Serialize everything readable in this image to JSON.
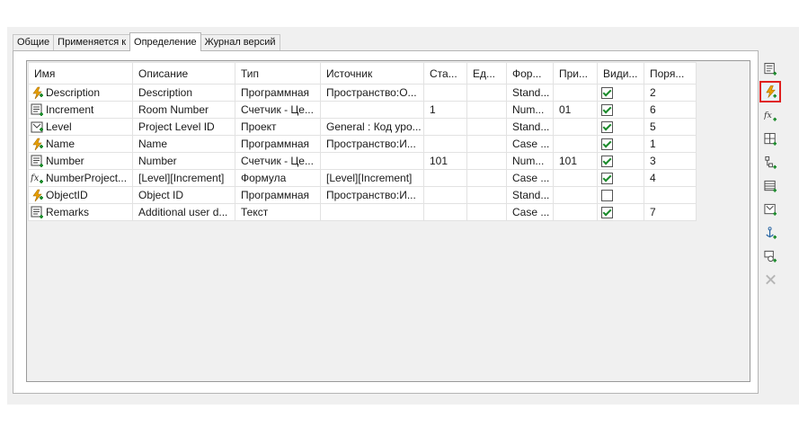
{
  "tabs": [
    "Общие",
    "Применяется к",
    "Определение",
    "Журнал версий"
  ],
  "active_tab": "Определение",
  "table": {
    "headers": [
      "Имя",
      "Описание",
      "Тип",
      "Источник",
      "Ста...",
      "Ед...",
      "Фор...",
      "При...",
      "Види...",
      "Поря..."
    ],
    "rows": [
      {
        "icon": "lightning-icon",
        "name": "Description",
        "desc": "Description",
        "type": "Программная",
        "source": "Пространство:О...",
        "start": "",
        "unit": "",
        "format": "Stand...",
        "prefix": "",
        "visible": true,
        "order": "2"
      },
      {
        "icon": "counter-icon",
        "name": "Increment",
        "desc": "Room Number",
        "type": "Счетчик - Це...",
        "source": "",
        "start": "1",
        "unit": "",
        "format": "Num...",
        "prefix": "01",
        "visible": true,
        "order": "6"
      },
      {
        "icon": "project-icon",
        "name": "Level",
        "desc": "Project Level ID",
        "type": "Проект",
        "source": "General : Код уро...",
        "start": "",
        "unit": "",
        "format": "Stand...",
        "prefix": "",
        "visible": true,
        "order": "5"
      },
      {
        "icon": "lightning-icon",
        "name": "Name",
        "desc": "Name",
        "type": "Программная",
        "source": "Пространство:И...",
        "start": "",
        "unit": "",
        "format": "Case ...",
        "prefix": "",
        "visible": true,
        "order": "1"
      },
      {
        "icon": "counter-icon",
        "name": "Number",
        "desc": "Number",
        "type": "Счетчик - Це...",
        "source": "",
        "start": "101",
        "unit": "",
        "format": "Num...",
        "prefix": "101",
        "visible": true,
        "order": "3"
      },
      {
        "icon": "formula-icon",
        "name": "NumberProject...",
        "desc": "[Level][Increment]",
        "type": "Формула",
        "source": "[Level][Increment]",
        "start": "",
        "unit": "",
        "format": "Case ...",
        "prefix": "",
        "visible": true,
        "order": "4"
      },
      {
        "icon": "lightning-icon",
        "name": "ObjectID",
        "desc": "Object ID",
        "type": "Программная",
        "source": "Пространство:И...",
        "start": "",
        "unit": "",
        "format": "Stand...",
        "prefix": "",
        "visible": false,
        "order": ""
      },
      {
        "icon": "counter-icon",
        "name": "Remarks",
        "desc": "Additional user d...",
        "type": "Текст",
        "source": "",
        "start": "",
        "unit": "",
        "format": "Case ...",
        "prefix": "",
        "visible": true,
        "order": "7"
      }
    ]
  },
  "toolbar": [
    {
      "icon": "add-counter-icon"
    },
    {
      "icon": "add-lightning-icon"
    },
    {
      "icon": "add-formula-icon"
    },
    {
      "icon": "add-grid-icon"
    },
    {
      "icon": "add-tree-icon"
    },
    {
      "icon": "add-table-icon"
    },
    {
      "icon": "add-project-icon"
    },
    {
      "icon": "add-anchor-icon"
    },
    {
      "icon": "add-link-icon"
    },
    {
      "icon": "delete-icon"
    }
  ],
  "colors": {
    "accent_green": "#1a8a2a",
    "highlight_red": "#e02020",
    "lightning": "#e8a000"
  }
}
